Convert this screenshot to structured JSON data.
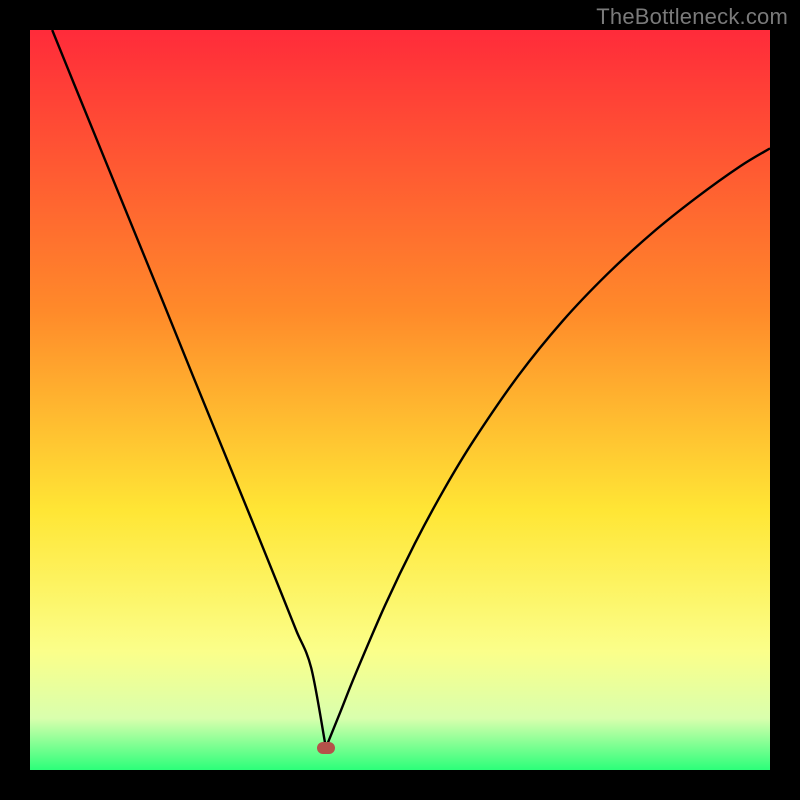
{
  "watermark": "TheBottleneck.com",
  "colors": {
    "gradient_top": "#ff2b3a",
    "gradient_mid1": "#ff8a2a",
    "gradient_mid2": "#ffe635",
    "gradient_mid3": "#fbff8a",
    "gradient_mid4": "#d9ffad",
    "gradient_bottom": "#2cff7a",
    "curve": "#000000",
    "marker": "#b5524a"
  },
  "chart_data": {
    "type": "line",
    "title": "",
    "xlabel": "",
    "ylabel": "",
    "xlim": [
      0,
      100
    ],
    "ylim": [
      0,
      100
    ],
    "grid": false,
    "series": [
      {
        "name": "curve",
        "x": [
          3,
          6,
          10,
          14,
          18,
          22,
          26,
          30,
          34,
          36,
          38,
          39.9,
          40,
          40.1,
          42,
          44,
          48,
          52,
          56,
          60,
          66,
          72,
          78,
          84,
          90,
          96,
          100
        ],
        "y": [
          100,
          92.6,
          82.8,
          73.0,
          63.2,
          53.3,
          43.5,
          33.7,
          23.8,
          18.8,
          13.8,
          3.5,
          3.0,
          3.3,
          8.0,
          13.0,
          22.3,
          30.6,
          38.0,
          44.6,
          53.3,
          60.7,
          67.0,
          72.5,
          77.3,
          81.6,
          84.0
        ]
      }
    ],
    "annotations": [
      {
        "name": "minimum-marker",
        "x": 40,
        "y": 3.0
      }
    ]
  }
}
